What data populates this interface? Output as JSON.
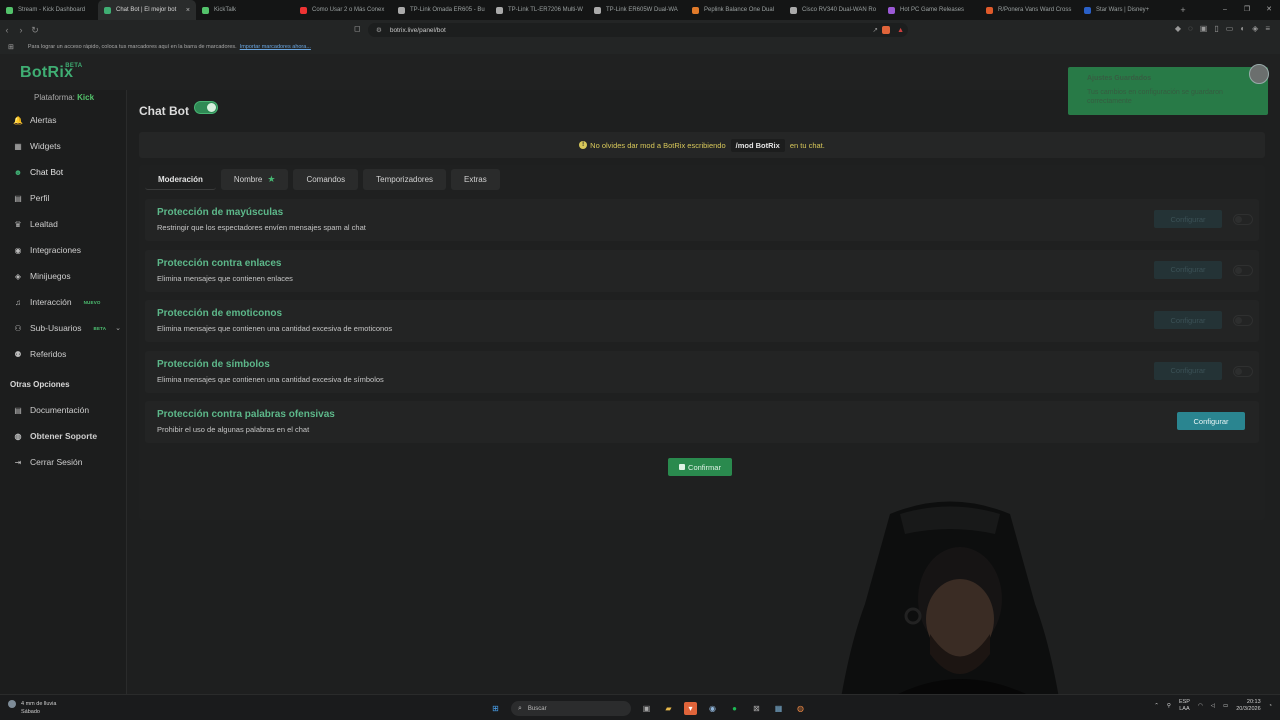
{
  "browser": {
    "tabs": [
      {
        "label": "Stream - Kick Dashboard",
        "color": "#53c36b",
        "active": false
      },
      {
        "label": "Chat Bot | El mejor bot",
        "color": "#3fae73",
        "active": true
      },
      {
        "label": "KickTalk",
        "color": "#53c36b",
        "active": false
      },
      {
        "label": "Como Usar 2 o Más Conex",
        "color": "#e33",
        "active": false
      },
      {
        "label": "TP-Link Omada ER605 - Bu",
        "color": "#aaa",
        "active": false
      },
      {
        "label": "TP-Link TL-ER7206 Multi-W",
        "color": "#aaa",
        "active": false
      },
      {
        "label": "TP-Link ER605W Dual-WA",
        "color": "#aaa",
        "active": false
      },
      {
        "label": "Peplink Balance One Dual",
        "color": "#e07a2a",
        "active": false
      },
      {
        "label": "Cisco RV340 Dual-WAN Ro",
        "color": "#aaa",
        "active": false
      },
      {
        "label": "Hot PC Game Releases",
        "color": "#9b59d6",
        "active": false
      },
      {
        "label": "R/Ponera Vans Ward Cross",
        "color": "#e05a2a",
        "active": false
      },
      {
        "label": "Star Wars | Disney+",
        "color": "#2a60c8",
        "active": false
      }
    ],
    "tab_close": "×",
    "new_tab": "+",
    "window_controls": [
      "–",
      "❐",
      "✕"
    ],
    "url": "botrix.live/panel/bot",
    "bookmarks_text": "Para lograr un acceso rápido, coloca tus marcadores aquí en la barra de marcadores.",
    "bookmarks_link": "Importar marcadores ahora..."
  },
  "app": {
    "logo": "BotRix",
    "logo_badge": "BETA",
    "platform_label": "Plataforma:",
    "platform_value": "Kick",
    "nav": [
      {
        "label": "Alertas",
        "icon": "bell-icon",
        "glyph": "🔔"
      },
      {
        "label": "Widgets",
        "icon": "widgets-icon",
        "glyph": "▦"
      },
      {
        "label": "Chat Bot",
        "icon": "robot-icon",
        "glyph": "☻"
      },
      {
        "label": "Perfil",
        "icon": "profile-icon",
        "glyph": "▤"
      },
      {
        "label": "Lealtad",
        "icon": "trophy-icon",
        "glyph": "♛"
      },
      {
        "label": "Integraciones",
        "icon": "integrations-icon",
        "glyph": "◉"
      },
      {
        "label": "Minijuegos",
        "icon": "gamepad-icon",
        "glyph": "◈"
      },
      {
        "label": "Interacción",
        "icon": "music-icon",
        "glyph": "♫",
        "badge": "NUEVO"
      },
      {
        "label": "Sub-Usuarios",
        "icon": "users-icon",
        "glyph": "⚇",
        "badge": "BETA",
        "chevron": "⌄"
      },
      {
        "label": "Referidos",
        "icon": "referrals-icon",
        "glyph": "⚉"
      }
    ],
    "other_title": "Otras Opciones",
    "other": [
      {
        "label": "Documentación",
        "icon": "document-icon",
        "glyph": "▤"
      },
      {
        "label": "Obtener Soporte",
        "icon": "support-icon",
        "glyph": "◍"
      },
      {
        "label": "Cerrar Sesión",
        "icon": "logout-icon",
        "glyph": "⇥"
      }
    ],
    "page_title": "Chat Bot",
    "notice_before": "No olvides dar mod a BotRix escribiendo",
    "notice_cmd": "/mod BotRix",
    "notice_after": "en tu chat.",
    "tabs": [
      "Moderación",
      "Nombre",
      "Comandos",
      "Temporizadores",
      "Extras"
    ],
    "rows": [
      {
        "title": "Protección de mayúsculas",
        "desc": "Restringir que los espectadores envíen mensajes spam al chat",
        "enabled": false
      },
      {
        "title": "Protección contra enlaces",
        "desc": "Elimina mensajes que contienen enlaces",
        "enabled": false
      },
      {
        "title": "Protección de emoticonos",
        "desc": "Elimina mensajes que contienen una cantidad excesiva de emoticonos",
        "enabled": false
      },
      {
        "title": "Protección de símbolos",
        "desc": "Elimina mensajes que contienen una cantidad excesiva de símbolos",
        "enabled": false
      },
      {
        "title": "Protección contra palabras ofensivas",
        "desc": "Prohibir el uso de algunas palabras en el chat",
        "enabled": true
      }
    ],
    "configure_label": "Configurar",
    "confirm_label": "Confirmar",
    "toast_title": "Ajustes Guardados",
    "toast_body": "Tus cambios en configuración se guardaron correctamente",
    "toast_close": "×",
    "accent": "#3fae73"
  },
  "taskbar": {
    "weather_line1": "4 mm de lluvia",
    "weather_line2": "Sábado",
    "search": "Buscar",
    "lang1": "ESP",
    "lang2": "LAA",
    "time": "20:13",
    "date": "20/3/2026"
  }
}
